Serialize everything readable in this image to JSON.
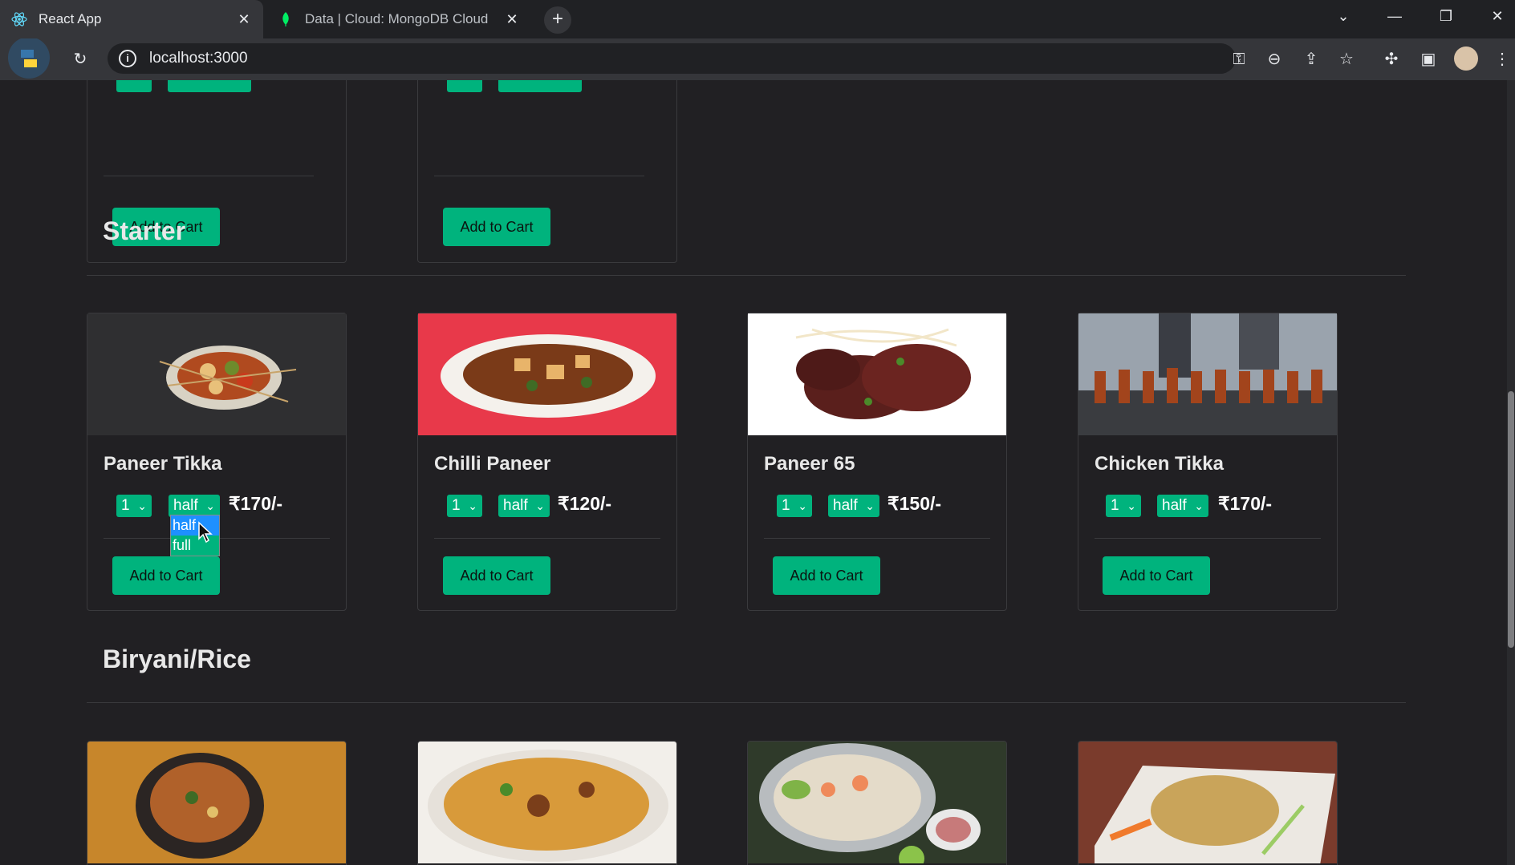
{
  "browser": {
    "tabs": [
      {
        "title": "React App"
      },
      {
        "title": "Data | Cloud: MongoDB Cloud"
      }
    ],
    "url": "localhost:3000"
  },
  "top_cards": [
    {
      "button": "Add to Cart"
    },
    {
      "button": "Add to Cart"
    }
  ],
  "sections": [
    {
      "title": "Starter"
    },
    {
      "title": "Biryani/Rice"
    }
  ],
  "starter_items": [
    {
      "name": "Paneer Tikka",
      "qty": "1",
      "size": "half",
      "price": "₹170/-",
      "button": "Add to Cart"
    },
    {
      "name": "Chilli Paneer",
      "qty": "1",
      "size": "half",
      "price": "₹120/-",
      "button": "Add to Cart"
    },
    {
      "name": "Paneer 65",
      "qty": "1",
      "size": "half",
      "price": "₹150/-",
      "button": "Add to Cart"
    },
    {
      "name": "Chicken Tikka",
      "qty": "1",
      "size": "half",
      "price": "₹170/-",
      "button": "Add to Cart"
    }
  ],
  "size_dropdown": {
    "options": [
      "half",
      "full"
    ],
    "highlighted": "half"
  },
  "colors": {
    "accent": "#00b37d",
    "background": "#212023"
  }
}
